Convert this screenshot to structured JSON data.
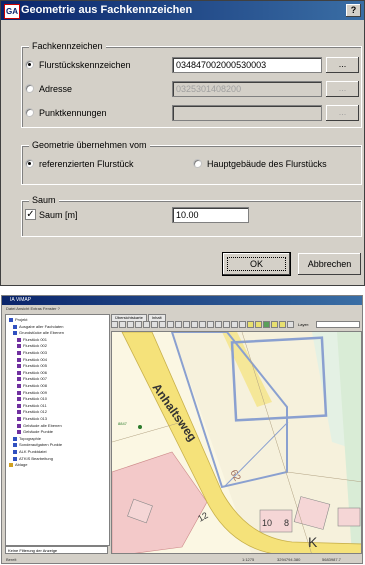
{
  "dialog": {
    "app_icon_text": "GA",
    "title": "Geometrie aus Fachkennzeichen",
    "help_label": "?",
    "fachkennzeichen": {
      "legend": "Fachkennzeichen",
      "options": [
        {
          "label": "Flurstückskennzeichen",
          "selected": true,
          "value": "034847002000530003",
          "enabled": true
        },
        {
          "label": "Adresse",
          "selected": false,
          "value": "0325301408200",
          "enabled": false
        },
        {
          "label": "Punktkennungen",
          "selected": false,
          "value": "",
          "enabled": false
        }
      ],
      "browse_label": "..."
    },
    "geometrie": {
      "legend": "Geometrie übernehmen vom",
      "option_left": "referenzierten Flurstück",
      "option_right": "Hauptgebäude des Flurstücks"
    },
    "saum": {
      "legend": "Saum",
      "checkbox_label": "Saum [m]",
      "checked": true,
      "value": "10.00"
    },
    "ok_label": "OK",
    "cancel_label": "Abbrechen"
  },
  "app": {
    "title": "IA ViMAP",
    "menu": "Datei   Ansicht   Extras   Fenster   ?",
    "tree_items": [
      "Projekt",
      "Ausgabe aller Fachdaten",
      "Grundstücke alle Ebenen",
      "Flurstück 001",
      "Flurstück 002",
      "Flurstück 003",
      "Flurstück 004",
      "Flurstück 005",
      "Flurstück 006",
      "Flurstück 007",
      "Flurstück 008",
      "Flurstück 009",
      "Flurstück 010",
      "Flurstück 011",
      "Flurstück 012",
      "Flurstück 013",
      "Gebäude alle Ebenen",
      "Gebäude Punkte",
      "Topographie",
      "Sonderaufgaben Punkte",
      "ALK Punktdatei",
      "ATKIS Bearbeitung",
      "Ablage"
    ],
    "tree_status": "Keine Filterung der Anzeige",
    "tabs": [
      "Übersichtskarte",
      "Inhalt"
    ],
    "layer_label": "Layer:",
    "map": {
      "street": "Anhaltsweg",
      "parcel_number": "62",
      "label_12": "12",
      "label_10": "10",
      "label_8": "8",
      "label_k": "K",
      "label_point": "8847"
    },
    "status": [
      "Bereit",
      "1:1275",
      "3294794.380",
      "5683987.7"
    ]
  },
  "colors": {
    "title_start": "#0a246a",
    "title_end": "#3a6ea5",
    "dialog_bg": "#d4d0c8",
    "map_bg": "#f6f1dc",
    "road": "#f5e27a",
    "parcel_outline": "#8aa0d0",
    "building_red": "#f3c9c9"
  }
}
